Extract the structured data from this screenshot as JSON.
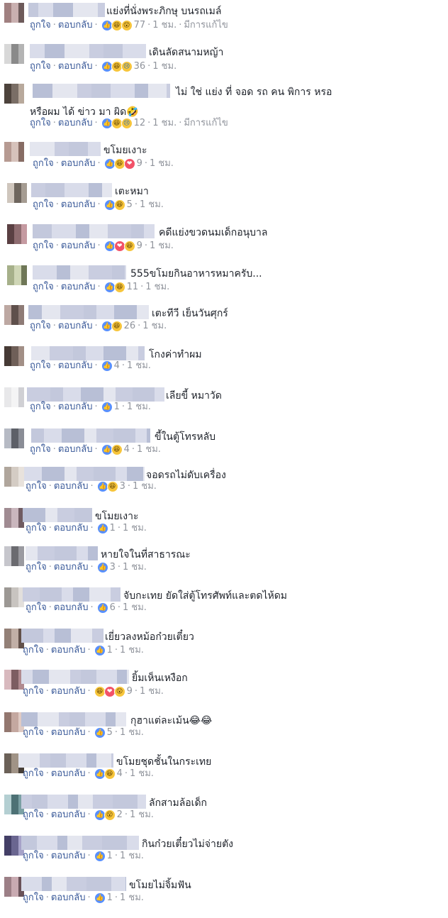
{
  "ui": {
    "like_label": "ถูกใจ",
    "reply_label": "ตอบกลับ",
    "time_label": "1 ชม.",
    "edited_label": "มีการแก้ไข",
    "separator": "·"
  },
  "comments": [
    {
      "text": "แย่งที่นั่งพระภิกษุ บนรถเมล์",
      "reactions": [
        "like",
        "haha",
        "wow"
      ],
      "count": "77",
      "edited": true
    },
    {
      "text": "เดินลัดสนามหญ้า",
      "reactions": [
        "like",
        "haha",
        "sad"
      ],
      "count": "36",
      "edited": false
    },
    {
      "text": "ไม่ ใช่ แย่ง ที่ จอด รถ คน พิการ หรอ",
      "text2": "หรือผม ได้ ข่าว มา ผิด🤣",
      "reactions": [
        "like",
        "haha",
        "sad"
      ],
      "count": "12",
      "edited": true
    },
    {
      "text": "ขโมยเงาะ",
      "reactions": [
        "like",
        "haha",
        "love"
      ],
      "count": "9",
      "edited": false
    },
    {
      "text": "เตะหมา",
      "reactions": [
        "like",
        "haha"
      ],
      "count": "5",
      "edited": false
    },
    {
      "text": "คดีแย่งขวดนมเด็กอนุบาล",
      "reactions": [
        "like",
        "love",
        "haha"
      ],
      "count": "9",
      "edited": false
    },
    {
      "text": "555ขโมยกินอาหารหมาครับ...",
      "reactions": [
        "like",
        "haha"
      ],
      "count": "11",
      "edited": false
    },
    {
      "text": "เตะทีวี เย็นวันศุกร์",
      "reactions": [
        "like",
        "haha"
      ],
      "count": "26",
      "edited": false
    },
    {
      "text": "โกงค่าทำผม",
      "reactions": [
        "like"
      ],
      "count": "4",
      "edited": false
    },
    {
      "text": "เลียขี้ หมาวัด",
      "reactions": [
        "like"
      ],
      "count": "1",
      "edited": false
    },
    {
      "text": "ขี้ในตู้โทรหลับ",
      "reactions": [
        "like",
        "haha"
      ],
      "count": "4",
      "edited": false
    },
    {
      "text": "จอดรถไม่ดับเครื่อง",
      "reactions": [
        "like",
        "haha"
      ],
      "count": "3",
      "edited": false
    },
    {
      "text": "ขโมยเงาะ",
      "reactions": [
        "like"
      ],
      "count": "1",
      "edited": false
    },
    {
      "text": "หายใจในที่สาธารณะ",
      "reactions": [
        "like"
      ],
      "count": "3",
      "edited": false
    },
    {
      "text": "จับกะเทย ยัดใส่ตู้โทรศัพท์และตดไห้ดม",
      "reactions": [
        "like"
      ],
      "count": "6",
      "edited": false
    },
    {
      "text": "เยี่ยวลงหม้อก๋วยเตี๋ยว",
      "reactions": [
        "like"
      ],
      "count": "1",
      "edited": false
    },
    {
      "text": "ยิ้มเห็นเหงือก",
      "reactions": [
        "haha",
        "love",
        "wow"
      ],
      "count": "9",
      "edited": false
    },
    {
      "text": "กุฮาแต่ละเม้น😂😂",
      "reactions": [
        "like"
      ],
      "count": "5",
      "edited": false
    },
    {
      "text": "ขโมยชุดชั้นในกระเทย",
      "reactions": [
        "like",
        "haha"
      ],
      "count": "4",
      "edited": false
    },
    {
      "text": "ลักสามล้อเด็ก",
      "reactions": [
        "like",
        "wow"
      ],
      "count": "2",
      "edited": false
    },
    {
      "text": "กินก๋วยเตี๋ยวไม่จ่ายตัง",
      "reactions": [
        "like"
      ],
      "count": "1",
      "edited": false
    },
    {
      "text": "ขโมยไม่จิ้มฟัน",
      "reactions": [
        "like"
      ],
      "count": "1",
      "edited": false
    }
  ]
}
